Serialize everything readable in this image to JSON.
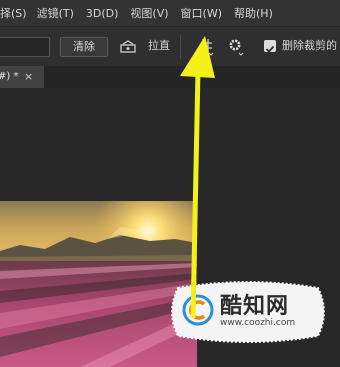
{
  "menubar": {
    "items": [
      {
        "label": "择(S)"
      },
      {
        "label": "滤镜(T)"
      },
      {
        "label": "3D(D)"
      },
      {
        "label": "视图(V)"
      },
      {
        "label": "窗口(W)"
      },
      {
        "label": "帮助(H)"
      }
    ]
  },
  "options": {
    "clear_label": "清除",
    "straighten_label": "拉直",
    "delete_cropped_label": "删除裁剪的"
  },
  "tab": {
    "title": "#) *",
    "close": "×"
  },
  "watermark": {
    "title": "酷知网",
    "url": "www.coozhi.com"
  },
  "colors": {
    "arrow": "#f3f01a",
    "menubar": "#333333",
    "canvas": "#282828"
  }
}
